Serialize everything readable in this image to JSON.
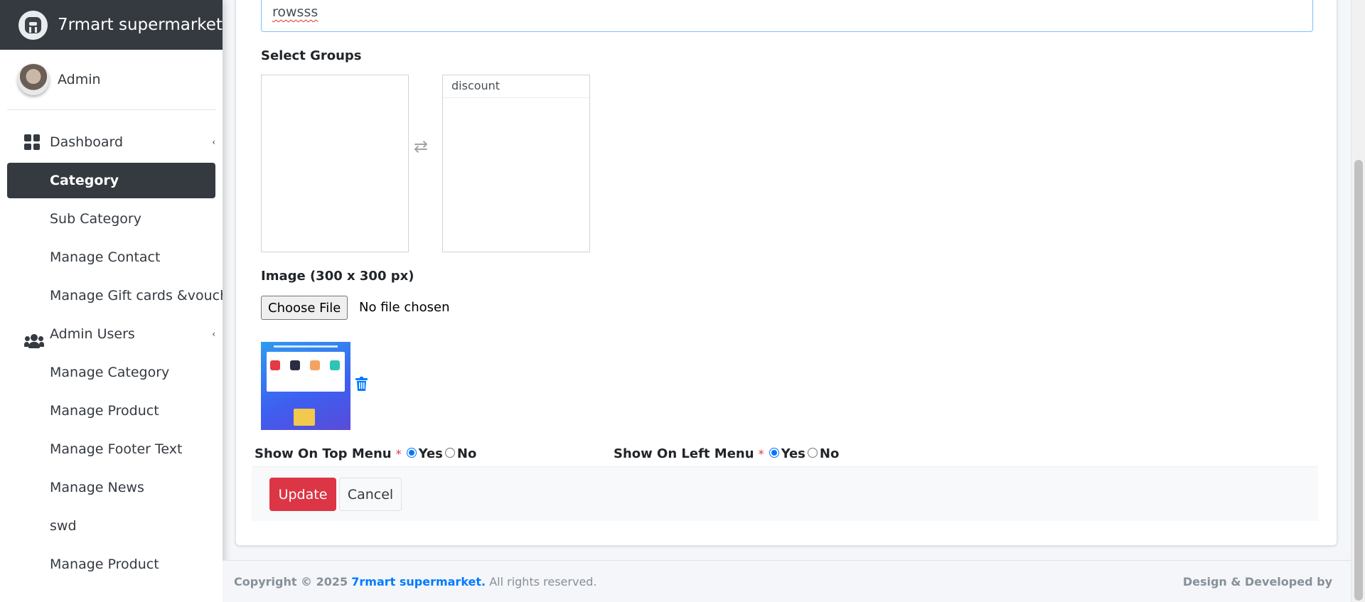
{
  "app": {
    "brand": "7rmart supermarket"
  },
  "user": {
    "name": "Admin"
  },
  "sidebar": {
    "items": [
      {
        "label": "Dashboard"
      },
      {
        "label": "Category"
      },
      {
        "label": "Sub Category"
      },
      {
        "label": "Manage Contact"
      },
      {
        "label": "Manage Gift cards &voucher"
      },
      {
        "label": "Admin Users"
      },
      {
        "label": "Manage Category"
      },
      {
        "label": "Manage Product"
      },
      {
        "label": "Manage Footer Text"
      },
      {
        "label": "Manage News"
      },
      {
        "label": "swd"
      },
      {
        "label": "Manage Product"
      }
    ],
    "active": "Category"
  },
  "form": {
    "name_value": "rowsss",
    "select_groups_label": "Select Groups",
    "available_groups": [],
    "selected_groups": [
      "discount"
    ],
    "image_label": "Image (300 x 300 px)",
    "file_button": "Choose File",
    "file_status": "No file chosen",
    "top_menu": {
      "label": "Show On Top Menu",
      "required_mark": "*",
      "yes": "Yes",
      "no": "No",
      "selected": "Yes"
    },
    "left_menu": {
      "label": "Show On Left Menu",
      "required_mark": "*",
      "yes": "Yes",
      "no": "No",
      "selected": "Yes"
    },
    "update_button": "Update",
    "cancel_button": "Cancel"
  },
  "footer": {
    "copyright_prefix": "Copyright © 2025",
    "brand_link": "7rmart supermarket.",
    "rights": "All rights reserved.",
    "developed": "Design & Developed by"
  },
  "colors": {
    "accent": "#007bff",
    "danger": "#dc3545",
    "sidebar_dark": "#343a40"
  }
}
